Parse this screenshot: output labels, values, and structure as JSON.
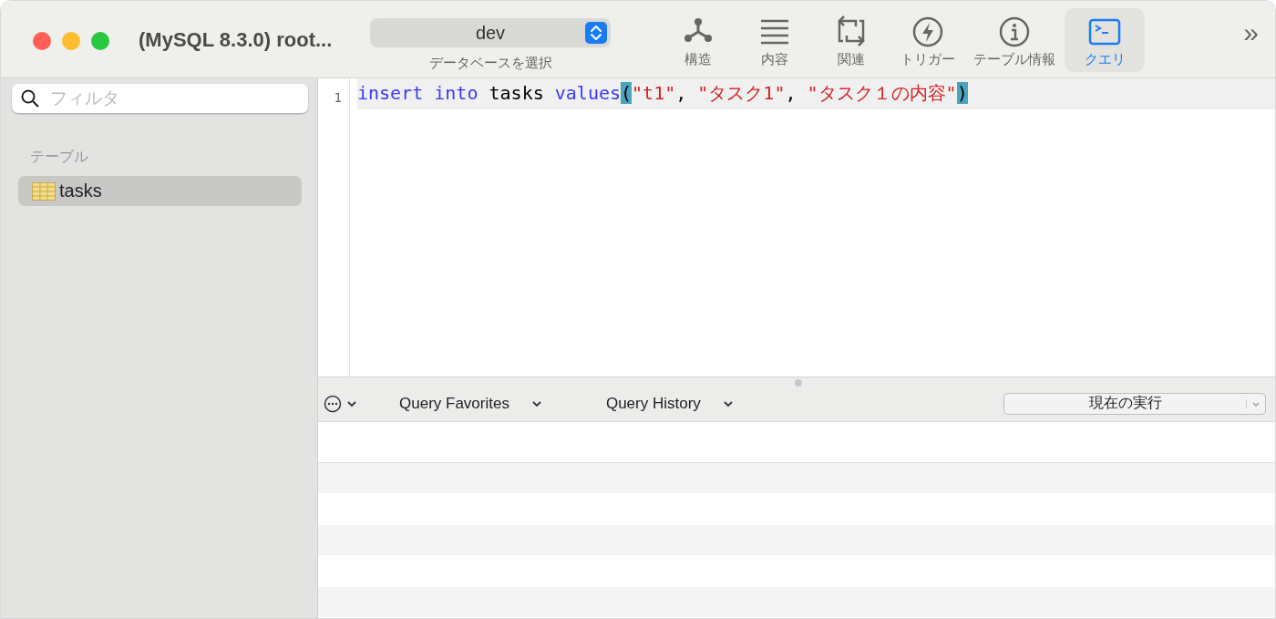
{
  "window": {
    "title": "(MySQL 8.3.0) root..."
  },
  "database": {
    "value": "dev",
    "label": "データベースを選択"
  },
  "toolbar": [
    {
      "label": "構造",
      "kind": "structure",
      "selected": false
    },
    {
      "label": "内容",
      "kind": "content",
      "selected": false
    },
    {
      "label": "関連",
      "kind": "relations",
      "selected": false
    },
    {
      "label": "トリガー",
      "kind": "trigger",
      "selected": false
    },
    {
      "label": "テーブル情報",
      "kind": "info",
      "selected": false
    },
    {
      "label": "クエリ",
      "kind": "query",
      "selected": true
    }
  ],
  "overflow": "»",
  "sidebar": {
    "search_placeholder": "フィルタ",
    "section": "テーブル",
    "items": [
      {
        "label": "tasks",
        "selected": true
      }
    ]
  },
  "editor": {
    "lines": [
      {
        "number": "1",
        "tokens": [
          {
            "kind": "keyword",
            "text": "insert"
          },
          {
            "kind": "keyword",
            "text": " into"
          },
          {
            "kind": "plain",
            "text": " tasks "
          },
          {
            "kind": "keyword",
            "text": "values"
          },
          {
            "kind": "bracket",
            "text": "("
          },
          {
            "kind": "string",
            "text": "\"t1\""
          },
          {
            "kind": "plain",
            "text": ", "
          },
          {
            "kind": "string",
            "text": "\"タスク1\""
          },
          {
            "kind": "plain",
            "text": ", "
          },
          {
            "kind": "string",
            "text": "\"タスク１の内容\""
          },
          {
            "kind": "bracket",
            "text": ")"
          }
        ]
      }
    ]
  },
  "query_bar": {
    "favorites": "Query Favorites",
    "history": "Query History",
    "run_mode": "現在の実行"
  }
}
